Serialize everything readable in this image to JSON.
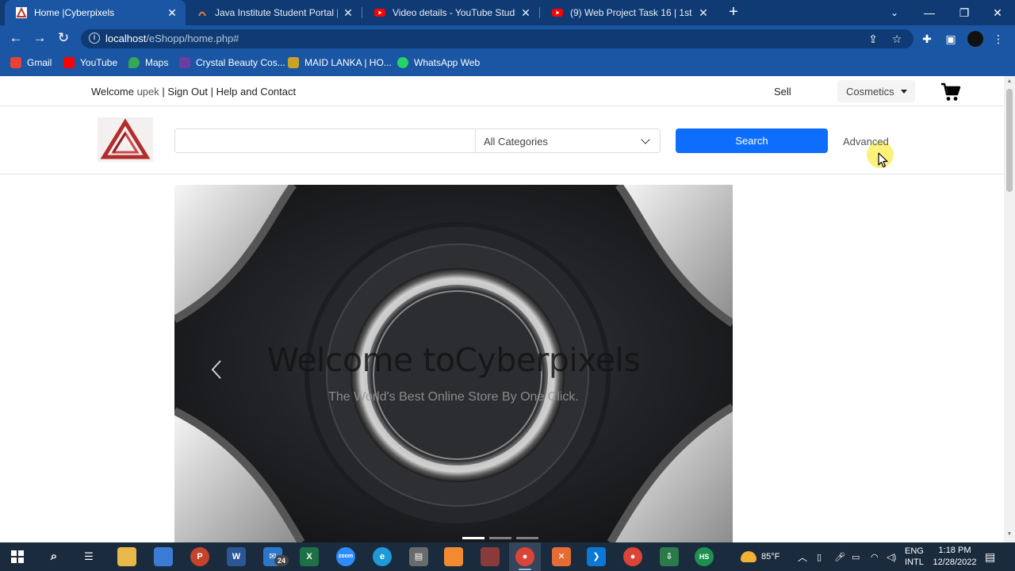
{
  "browser": {
    "tabs": [
      {
        "title": "Home |Cyberpixels",
        "active": true
      },
      {
        "title": "Java Institute Student Portal | Lo",
        "active": false
      },
      {
        "title": "Video details - YouTube Studio",
        "active": false
      },
      {
        "title": "(9) Web Project Task 16 | 1st Yea",
        "active": false
      }
    ],
    "url_host": "localhost",
    "url_path": "/eShopp/home.php#",
    "bookmarks": [
      {
        "label": "Gmail",
        "color": "#ea4335"
      },
      {
        "label": "YouTube",
        "color": "#ff0000"
      },
      {
        "label": "Maps",
        "color": "#34a853"
      },
      {
        "label": "Crystal Beauty Cos...",
        "color": "#6b3fa0"
      },
      {
        "label": "MAID LANKA | HO...",
        "color": "#c9a227"
      },
      {
        "label": "WhatsApp Web",
        "color": "#25d366"
      }
    ]
  },
  "header": {
    "welcome_label": "Welcome",
    "username": "upek",
    "sign_out": "Sign Out",
    "help": "Help and Contact",
    "separator": "|",
    "sell": "Sell",
    "category_menu": "Cosmetics"
  },
  "search": {
    "placeholder": "",
    "category_selected": "All Categories",
    "button": "Search",
    "advanced": "Advanced"
  },
  "carousel": {
    "title": "Welcome toCyberpixels",
    "subtitle": "The World's Best Online Store By One Click.",
    "slide_count": 3,
    "active_slide": 1
  },
  "taskbar": {
    "weather": "85°F",
    "lang_top": "ENG",
    "lang_bottom": "INTL",
    "time": "1:18 PM",
    "date": "12/28/2022",
    "mail_badge": "24"
  },
  "colors": {
    "primary": "#0d6efd",
    "chrome": "#1a56a4",
    "chrome_dark": "#0f3a73"
  }
}
